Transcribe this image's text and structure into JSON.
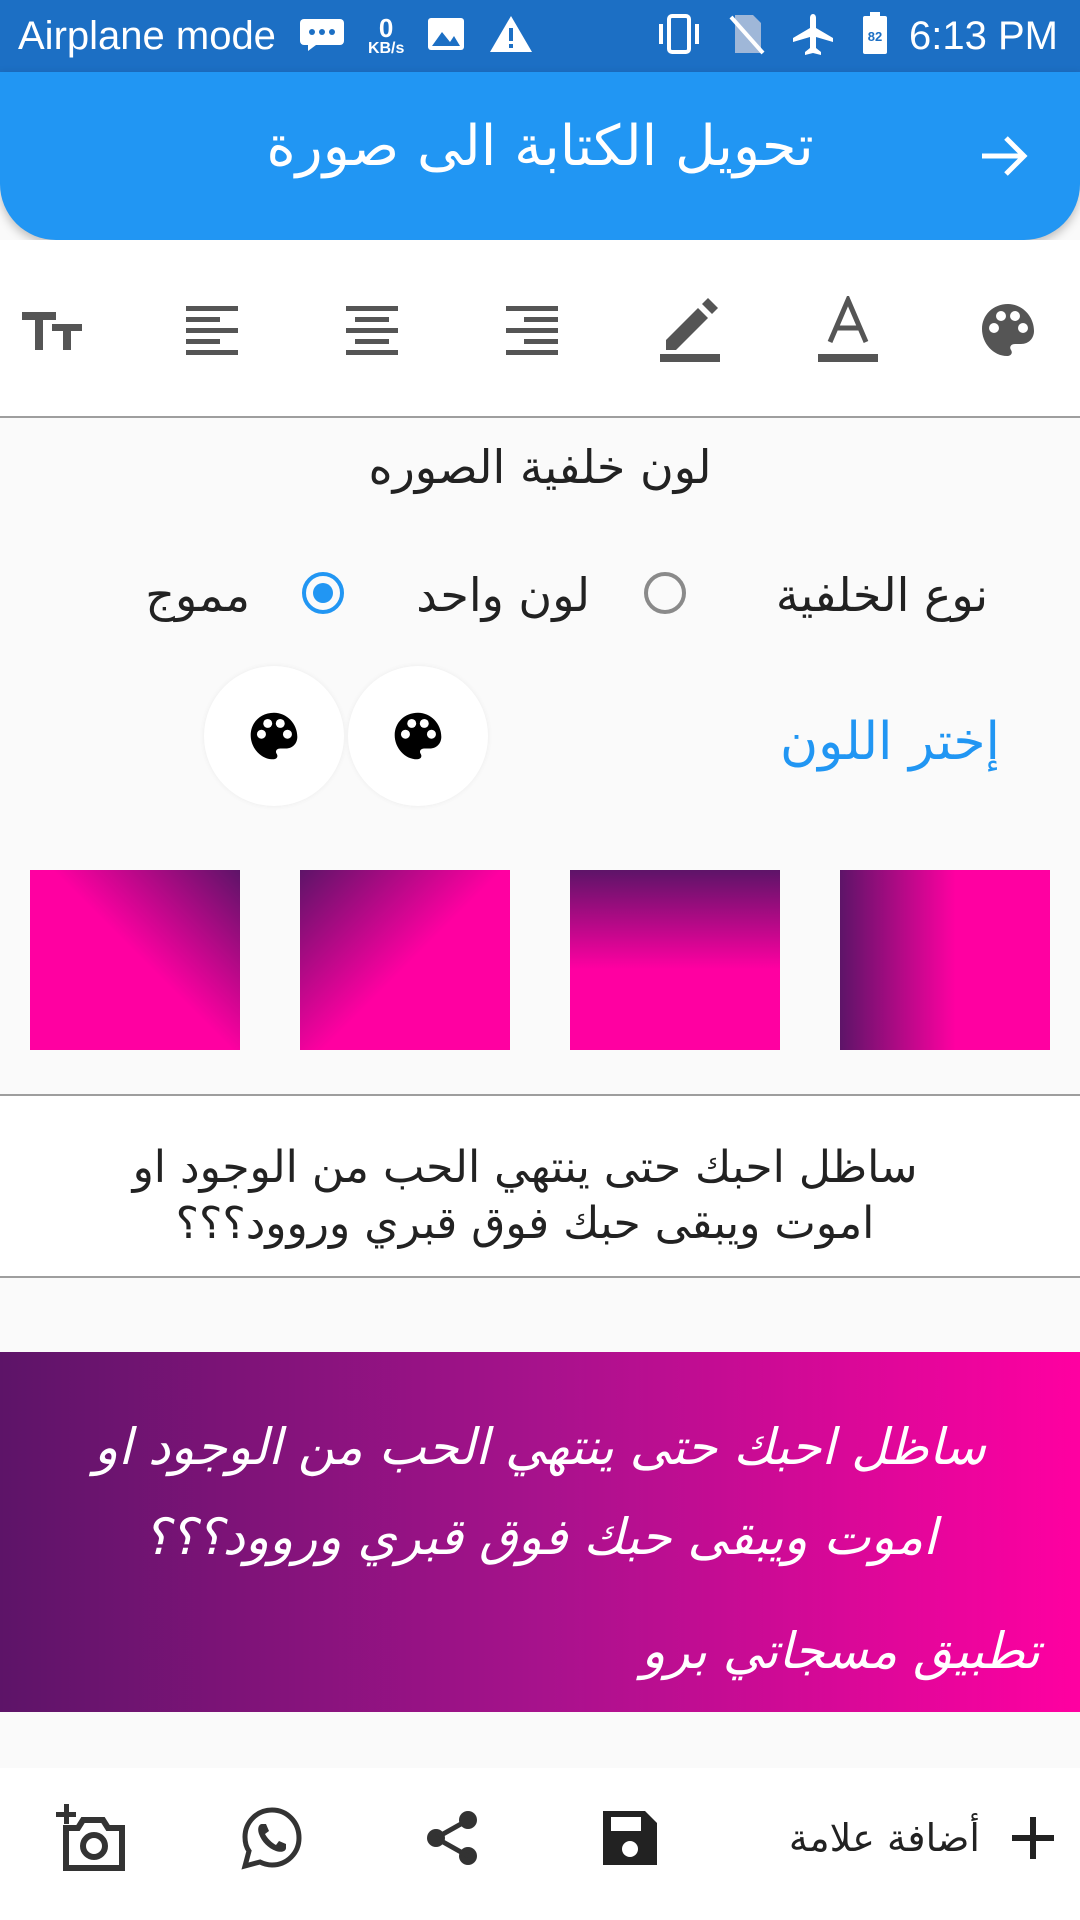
{
  "status_bar": {
    "mode": "Airplane mode",
    "speed_value": "0",
    "speed_unit": "KB/s",
    "battery_level": "82",
    "time": "6:13 PM"
  },
  "app_bar": {
    "title": "تحويل الكتابة الى صورة",
    "back_icon": "arrow-right-icon"
  },
  "toolbar": {
    "tools": [
      "text-size-icon",
      "align-left-icon",
      "align-center-icon",
      "align-right-icon",
      "pencil-icon",
      "text-color-icon",
      "palette-icon"
    ]
  },
  "background": {
    "title": "لون خلفية الصوره",
    "type_label": "نوع الخلفية",
    "options": [
      {
        "label": "لون واحد",
        "selected": false
      },
      {
        "label": "مموج",
        "selected": true
      }
    ],
    "choose_color_label": "إختر اللون",
    "gradient_colors": [
      "#5d1468",
      "#ff00a1"
    ],
    "swatches": [
      "diagonal-bottom-left",
      "diagonal-top-left",
      "vertical",
      "horizontal"
    ]
  },
  "text_input": {
    "value_line1": "ساظل احبك حتى ينتهي الحب من الوجود او",
    "value_line2": "اموت ويبقى حبك فوق قبري وروود؟؟؟"
  },
  "preview": {
    "line1": "ساظل احبك حتى ينتهي الحب من الوجود او",
    "line2": "اموت ويبقى حبك فوق قبري وروود؟؟؟",
    "signature": "تطبيق مسجاتي برو"
  },
  "bottom_bar": {
    "add_mark_label": "أضافة علامة",
    "icons": [
      "add-photo-icon",
      "whatsapp-icon",
      "share-icon",
      "save-icon",
      "plus-icon"
    ]
  }
}
